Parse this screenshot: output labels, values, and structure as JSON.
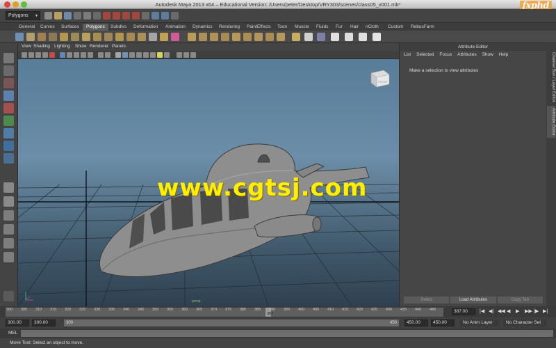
{
  "window": {
    "title": "Autodesk Maya 2013 x64 – Educational Version: /Users/peter/Desktop/VRY303/scenes/class05_v001.mb*",
    "brand_logo": "fxphd"
  },
  "statusline": {
    "menu_set": "Polygons"
  },
  "shelf": {
    "tabs": [
      "General",
      "Curves",
      "Surfaces",
      "Polygons",
      "Subdivs",
      "Deformation",
      "Animation",
      "Dynamics",
      "Rendering",
      "PaintEffects",
      "Toon",
      "Muscle",
      "Fluids",
      "Fur",
      "Hair",
      "nCloth",
      "Custom",
      "RebusFarm"
    ],
    "active_tab": "Polygons"
  },
  "viewport": {
    "menu": [
      "View",
      "Shading",
      "Lighting",
      "Show",
      "Renderer",
      "Panels"
    ],
    "view_cube_label": "FRONT",
    "camera_label": "persp",
    "watermark": "www.cgtsj.com"
  },
  "attribute_editor": {
    "title": "Attribute Editor",
    "menu": [
      "List",
      "Selected",
      "Focus",
      "Attributes",
      "Show",
      "Help"
    ],
    "hint": "Make a selection to view attributes",
    "buttons": {
      "select": "Select",
      "load": "Load Attributes",
      "copy": "Copy Tab"
    }
  },
  "side_tabs": [
    "Channel Box / Layer Editor",
    "Attribute Editor"
  ],
  "timeline": {
    "ticks": [
      "300",
      "305",
      "310",
      "315",
      "320",
      "325",
      "330",
      "335",
      "340",
      "345",
      "350",
      "355",
      "360",
      "365",
      "370",
      "375",
      "380",
      "385",
      "390",
      "395",
      "400",
      "405",
      "410",
      "415",
      "420",
      "425",
      "430",
      "435",
      "440",
      "445"
    ],
    "current_frame": "387",
    "current_frame_field": "387.00"
  },
  "range": {
    "start_field": "300.00",
    "playback_start": "300.00",
    "slider_start": "300",
    "slider_end": "450",
    "playback_end": "450.00",
    "end_field": "450.00",
    "anim_layer": "No Anim Layer",
    "character_set": "No Character Set"
  },
  "command_line": {
    "label": "MEL"
  },
  "help_line": {
    "text": "Move Tool: Select an object to move."
  },
  "colors": {
    "viewport_top": "#587d99",
    "viewport_bottom": "#2f4150",
    "watermark": "#ffee00",
    "panel": "#444444"
  }
}
